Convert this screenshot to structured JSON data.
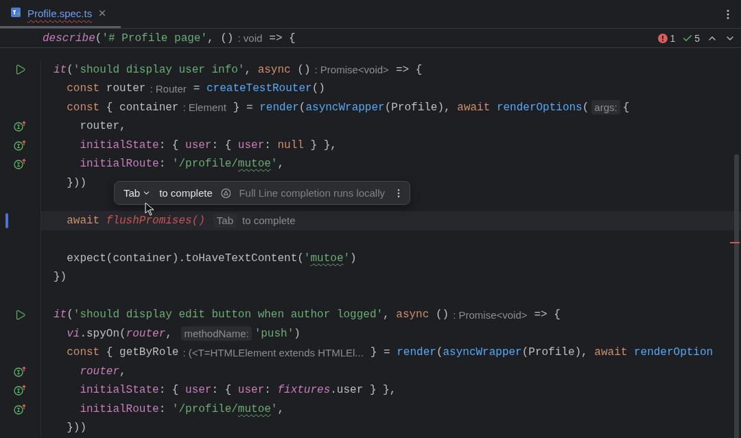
{
  "tab": {
    "title": "Profile.spec.ts",
    "selected": true,
    "has_error": true
  },
  "sticky_line": {
    "tokens": [
      {
        "kind": "call",
        "text": "describe"
      },
      {
        "kind": "plain",
        "text": "("
      },
      {
        "kind": "str",
        "text": "'# Profile page'"
      },
      {
        "kind": "plain",
        "text": ", ()"
      },
      {
        "kind": "hint",
        "text": ": void"
      },
      {
        "kind": "plain",
        "text": "=> {"
      }
    ]
  },
  "problems": {
    "errors": "1",
    "warnings": "5"
  },
  "lines": [
    {
      "kind": "run",
      "current": false,
      "tokens": [
        {
          "kind": "call",
          "text": "it"
        },
        {
          "kind": "plain",
          "text": "("
        },
        {
          "kind": "str",
          "text": "'should display user info'"
        },
        {
          "kind": "plain",
          "text": ", "
        },
        {
          "kind": "kw",
          "text": "async"
        },
        {
          "kind": "plain",
          "text": " ()"
        },
        {
          "kind": "hint",
          "text": ": Promise<void>"
        },
        {
          "kind": "plain",
          "text": "=> {"
        }
      ]
    },
    {
      "kind": "plain",
      "current": false,
      "tokens": [
        {
          "kind": "kw",
          "text": "  const"
        },
        {
          "kind": "plain",
          "text": " router"
        },
        {
          "kind": "hint",
          "text": ": Router"
        },
        {
          "kind": "plain",
          "text": "= "
        },
        {
          "kind": "fn",
          "text": "createTestRouter"
        },
        {
          "kind": "plain",
          "text": "()"
        }
      ]
    },
    {
      "kind": "plain",
      "current": false,
      "tokens": [
        {
          "kind": "kw",
          "text": "  const"
        },
        {
          "kind": "plain",
          "text": " { container"
        },
        {
          "kind": "hint",
          "text": ": Element"
        },
        {
          "kind": "plain",
          "text": "} = "
        },
        {
          "kind": "fn",
          "text": "render"
        },
        {
          "kind": "plain",
          "text": "("
        },
        {
          "kind": "fn",
          "text": "asyncWrapper"
        },
        {
          "kind": "plain",
          "text": "(Profile), "
        },
        {
          "kind": "kw",
          "text": "await "
        },
        {
          "kind": "fn",
          "text": "renderOptions"
        },
        {
          "kind": "plain",
          "text": "("
        },
        {
          "kind": "param",
          "text": "args:"
        },
        {
          "kind": "plain",
          "text": "{"
        }
      ]
    },
    {
      "kind": "implement",
      "current": false,
      "tokens": [
        {
          "kind": "plain",
          "text": "    router,"
        }
      ]
    },
    {
      "kind": "implement",
      "current": false,
      "tokens": [
        {
          "kind": "prop",
          "text": "    initialState"
        },
        {
          "kind": "plain",
          "text": ": { "
        },
        {
          "kind": "prop",
          "text": "user"
        },
        {
          "kind": "plain",
          "text": ": { "
        },
        {
          "kind": "prop",
          "text": "user"
        },
        {
          "kind": "plain",
          "text": ": "
        },
        {
          "kind": "kw",
          "text": "null"
        },
        {
          "kind": "plain",
          "text": " } },"
        }
      ]
    },
    {
      "kind": "implement",
      "current": false,
      "tokens": [
        {
          "kind": "prop",
          "text": "    initialRoute"
        },
        {
          "kind": "plain",
          "text": ": "
        },
        {
          "kind": "str",
          "text": "'/profile/"
        },
        {
          "kind": "typo",
          "text": "mutoe"
        },
        {
          "kind": "str",
          "text": "'"
        },
        {
          "kind": "plain",
          "text": ","
        }
      ]
    },
    {
      "kind": "plain",
      "current": false,
      "tokens": [
        {
          "kind": "plain",
          "text": "  }))"
        }
      ]
    },
    {
      "kind": "plain",
      "current": false
    },
    {
      "kind": "plain",
      "current": true,
      "tokens": [
        {
          "kind": "kw",
          "text": "  await "
        },
        {
          "kind": "ghost",
          "text": "flushPromises()"
        },
        {
          "kind": "tabkey",
          "text": "Tab"
        },
        {
          "kind": "ghosttext",
          "text": "to complete"
        }
      ]
    },
    {
      "kind": "plain",
      "current": false
    },
    {
      "kind": "plain",
      "current": false,
      "tokens": [
        {
          "kind": "plain",
          "text": "  expect(container).toHaveTextContent("
        },
        {
          "kind": "str",
          "text": "'"
        },
        {
          "kind": "typo",
          "text": "mutoe"
        },
        {
          "kind": "str",
          "text": "'"
        },
        {
          "kind": "plain",
          "text": ")"
        }
      ]
    },
    {
      "kind": "plain",
      "current": false,
      "tokens": [
        {
          "kind": "plain",
          "text": "})"
        }
      ]
    },
    {
      "kind": "plain",
      "current": false
    },
    {
      "kind": "run",
      "current": false,
      "tokens": [
        {
          "kind": "call",
          "text": "it"
        },
        {
          "kind": "plain",
          "text": "("
        },
        {
          "kind": "str",
          "text": "'should display edit button when author logged'"
        },
        {
          "kind": "plain",
          "text": ", "
        },
        {
          "kind": "kw",
          "text": "async"
        },
        {
          "kind": "plain",
          "text": " ()"
        },
        {
          "kind": "hint",
          "text": ": Promise<void>"
        },
        {
          "kind": "plain",
          "text": "=> {"
        }
      ]
    },
    {
      "kind": "plain",
      "current": false,
      "tokens": [
        {
          "kind": "glob",
          "text": "  vi"
        },
        {
          "kind": "plain",
          "text": ".spyOn("
        },
        {
          "kind": "glob",
          "text": "router"
        },
        {
          "kind": "plain",
          "text": ", "
        },
        {
          "kind": "param",
          "text": "methodName:"
        },
        {
          "kind": "str",
          "text": "'push'"
        },
        {
          "kind": "plain",
          "text": ")"
        }
      ]
    },
    {
      "kind": "plain",
      "current": false,
      "tokens": [
        {
          "kind": "kw",
          "text": "  const"
        },
        {
          "kind": "plain",
          "text": " { getByRole"
        },
        {
          "kind": "hint",
          "text": ": (<T=HTMLElement extends HTMLEl..."
        },
        {
          "kind": "plain",
          "text": "} = "
        },
        {
          "kind": "fn",
          "text": "render"
        },
        {
          "kind": "plain",
          "text": "("
        },
        {
          "kind": "fn",
          "text": "asyncWrapper"
        },
        {
          "kind": "plain",
          "text": "(Profile), "
        },
        {
          "kind": "kw",
          "text": "await "
        },
        {
          "kind": "fn",
          "text": "renderOption"
        }
      ]
    },
    {
      "kind": "implement",
      "current": false,
      "tokens": [
        {
          "kind": "glob",
          "text": "    router"
        },
        {
          "kind": "plain",
          "text": ","
        }
      ]
    },
    {
      "kind": "implement",
      "current": false,
      "tokens": [
        {
          "kind": "prop",
          "text": "    initialState"
        },
        {
          "kind": "plain",
          "text": ": { "
        },
        {
          "kind": "prop",
          "text": "user"
        },
        {
          "kind": "plain",
          "text": ": { "
        },
        {
          "kind": "prop",
          "text": "user"
        },
        {
          "kind": "plain",
          "text": ": "
        },
        {
          "kind": "glob",
          "text": "fixtures"
        },
        {
          "kind": "plain",
          "text": ".user } },"
        }
      ]
    },
    {
      "kind": "implement",
      "current": false,
      "tokens": [
        {
          "kind": "prop",
          "text": "    initialRoute"
        },
        {
          "kind": "plain",
          "text": ": "
        },
        {
          "kind": "str",
          "text": "'/profile/"
        },
        {
          "kind": "typo",
          "text": "mutoe"
        },
        {
          "kind": "str",
          "text": "'"
        },
        {
          "kind": "plain",
          "text": ","
        }
      ]
    },
    {
      "kind": "plain",
      "current": false,
      "tokens": [
        {
          "kind": "plain",
          "text": "  }))"
        }
      ]
    }
  ],
  "popup": {
    "key": "Tab",
    "label": "to complete",
    "note": "Full Line completion runs locally"
  }
}
